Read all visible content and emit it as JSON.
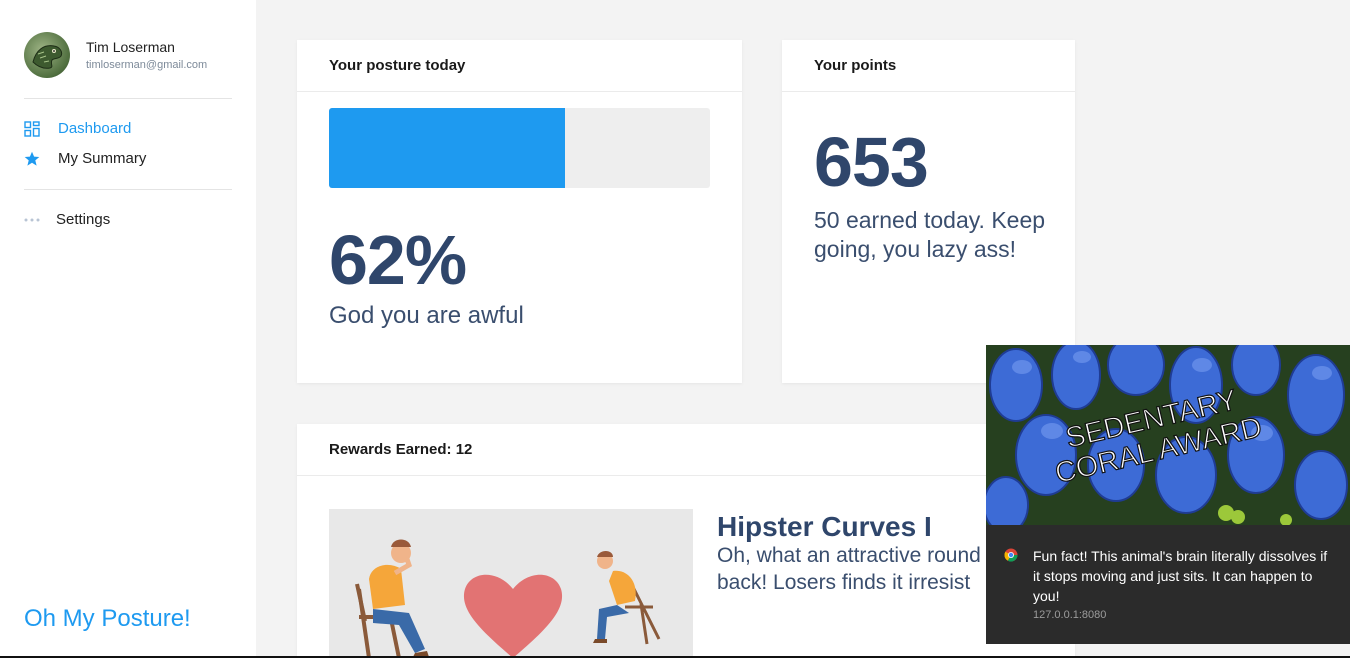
{
  "user": {
    "name": "Tim Loserman",
    "email": "timloserman@gmail.com"
  },
  "nav": {
    "dashboard": "Dashboard",
    "summary": "My Summary",
    "settings": "Settings"
  },
  "brand": "Oh My Posture!",
  "posture": {
    "title": "Your posture today",
    "percent_label": "62%",
    "progress": 0.62,
    "message": "God you are awful"
  },
  "points": {
    "title": "Your points",
    "value": "653",
    "message": "50 earned today. Keep going, you lazy ass!"
  },
  "rewards": {
    "title": "Rewards Earned: 12",
    "item": {
      "title": "Hipster Curves I",
      "description_line1": "Oh, what an attractive round",
      "description_line2": "back! Losers finds it irresist"
    }
  },
  "notification": {
    "image_caption_line1": "SEDENTARY",
    "image_caption_line2": "CORAL AWARD",
    "message": "Fun fact! This animal's brain literally dissolves if it stops moving and just sits. It can happen to you!",
    "source": "127.0.0.1:8080"
  },
  "colors": {
    "accent": "#1e9af0",
    "heading": "#2f466b",
    "background": "#f3f3f3"
  }
}
